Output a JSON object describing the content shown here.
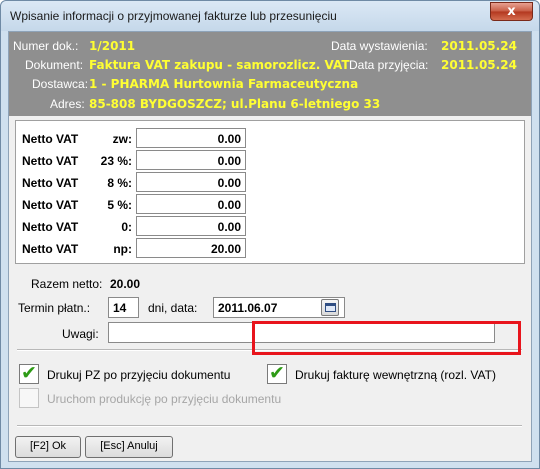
{
  "window": {
    "title": "Wpisanie informacji o przyjmowanej fakturze lub przesunięciu",
    "close_label": "x"
  },
  "header": {
    "doc_no_label": "Numer dok.:",
    "doc_no": "1/2011",
    "issue_date_label": "Data wystawienia:",
    "issue_date": "2011.05.24",
    "document_label": "Dokument:",
    "document": "Faktura VAT zakupu - samorozlicz. VAT",
    "receipt_date_label": "Data przyjęcia:",
    "receipt_date": "2011.05.24",
    "supplier_label": "Dostawca:",
    "supplier": "1 - PHARMA Hurtownia Farmaceutyczna",
    "address_label": "Adres:",
    "address": "85-808 BYDGOSZCZ; ul.Planu 6-letniego 33"
  },
  "vat_rows": [
    {
      "label": "Netto VAT",
      "rate": "zw:",
      "value": "0.00"
    },
    {
      "label": "Netto VAT",
      "rate": "23 %:",
      "value": "0.00"
    },
    {
      "label": "Netto VAT",
      "rate": "8 %:",
      "value": "0.00"
    },
    {
      "label": "Netto VAT",
      "rate": "5 %:",
      "value": "0.00"
    },
    {
      "label": "Netto VAT",
      "rate": "0:",
      "value": "0.00"
    },
    {
      "label": "Netto VAT",
      "rate": "np:",
      "value": "20.00"
    }
  ],
  "totals": {
    "net_label": "Razem netto:",
    "net_value": "20.00"
  },
  "payment": {
    "term_label": "Termin płatn.:",
    "term_days": "14",
    "days_label": "dni, data:",
    "due_date": "2011.06.07"
  },
  "notes": {
    "label": "Uwagi:",
    "value": ""
  },
  "options": {
    "print_pz": "Drukuj PZ po przyjęciu dokumentu",
    "print_internal": "Drukuj fakturę wewnętrzną (rozl. VAT)",
    "start_production": "Uruchom produkcję po przyjęciu dokumentu"
  },
  "buttons": {
    "ok": "[F2] Ok",
    "cancel": "[Esc] Anuluj"
  },
  "colors": {
    "header_bg": "#8f8f8f",
    "header_value": "#ffff33",
    "highlight": "#e8141c",
    "check": "#2e9b16"
  }
}
